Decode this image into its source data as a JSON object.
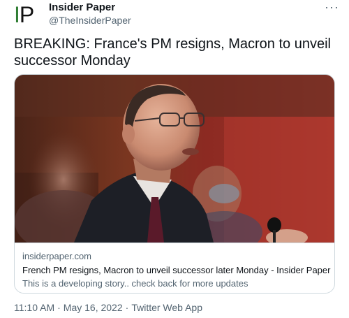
{
  "author": {
    "avatar": {
      "letters": [
        "I",
        "P"
      ],
      "colors": {
        "I": "#2e7d32",
        "P": "#111111"
      }
    },
    "name": "Insider Paper",
    "handle": "@TheInsiderPaper"
  },
  "more_label": "···",
  "tweet_text": "BREAKING: France's PM resigns, Macron to unveil successor Monday",
  "link_card": {
    "image_description": "photo",
    "domain": "insiderpaper.com",
    "title": "French PM resigns, Macron to unveil successor later Monday - Insider Paper",
    "description": "This is a developing story.. check back for more updates"
  },
  "meta": {
    "time": "11:10 AM",
    "date": "May 16, 2022",
    "source": "Twitter Web App",
    "separator": "·"
  },
  "colors": {
    "text": "#0f1419",
    "secondary": "#536471",
    "border": "#cfd9de"
  }
}
